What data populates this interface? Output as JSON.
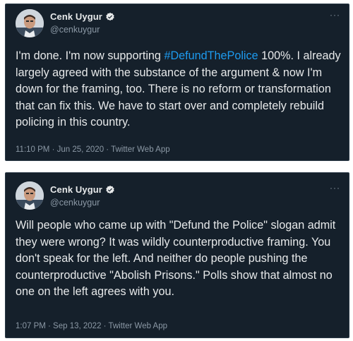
{
  "tweets": [
    {
      "display_name": "Cenk Uygur",
      "handle": "@cenkuygur",
      "text_before": "I'm done. I'm now supporting ",
      "hashtag": "#DefundThePolice",
      "text_after": " 100%. I already largely agreed with the substance of the argument & now I'm down for the framing, too. There is no reform or transformation that can fix this. We have to start over and completely rebuild policing in this country.",
      "timestamp": "11:10 PM · Jun 25, 2020 · Twitter Web App"
    },
    {
      "display_name": "Cenk Uygur",
      "handle": "@cenkuygur",
      "text": "Will people who came up with \"Defund the Police\" slogan admit they were wrong? It was wildly counterproductive framing. You don't speak for the left. And neither do people pushing the counterproductive \"Abolish Prisons.\" Polls show that almost no one on the left agrees with you.",
      "timestamp": "1:07 PM · Sep 13, 2022 · Twitter Web App"
    }
  ],
  "colors": {
    "background": "#15202b",
    "text": "#e7e9ea",
    "muted": "#8b98a5",
    "accent": "#1d9bf0"
  },
  "icons": {
    "verified": "verified-badge-icon",
    "more": "more-options-icon",
    "avatar": "profile-photo"
  }
}
